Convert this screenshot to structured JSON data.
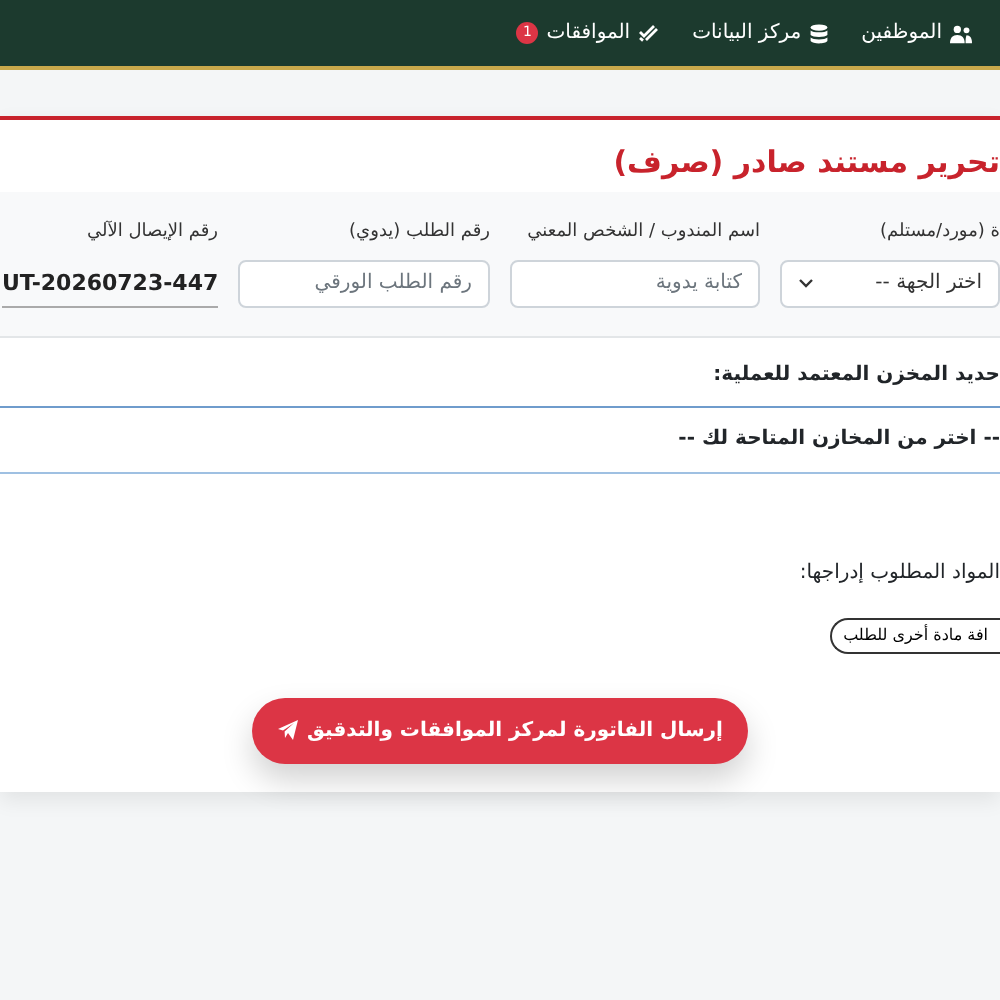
{
  "navbar": {
    "items": [
      {
        "label": "الموظفين"
      },
      {
        "label": "مركز البيانات"
      },
      {
        "label": "الموافقات",
        "badge": "1"
      }
    ]
  },
  "title": "تحرير مستند صادر (صرف)",
  "fields": [
    {
      "kind": "select",
      "label": "ة (مورد/مستلم)",
      "value": "اختر الجهة --"
    },
    {
      "kind": "input",
      "label": "اسم المندوب / الشخص المعني",
      "placeholder": "كتابة يدوية"
    },
    {
      "kind": "input",
      "label": "رقم الطلب (يدوي)",
      "placeholder": "رقم الطلب الورقي"
    },
    {
      "kind": "readonly",
      "label": "رقم الإيصال الآلي",
      "value": "UT-20260723-447"
    }
  ],
  "warehouse": {
    "label": "حديد المخزن المعتمد للعملية:",
    "value": "-- اختر من المخازن المتاحة لك --"
  },
  "items_section": {
    "label": "المواد المطلوب إدراجها:",
    "add_button": "افة مادة أخرى للطلب"
  },
  "submit_button": "إرسال الفاتورة لمركز الموافقات والتدقيق"
}
